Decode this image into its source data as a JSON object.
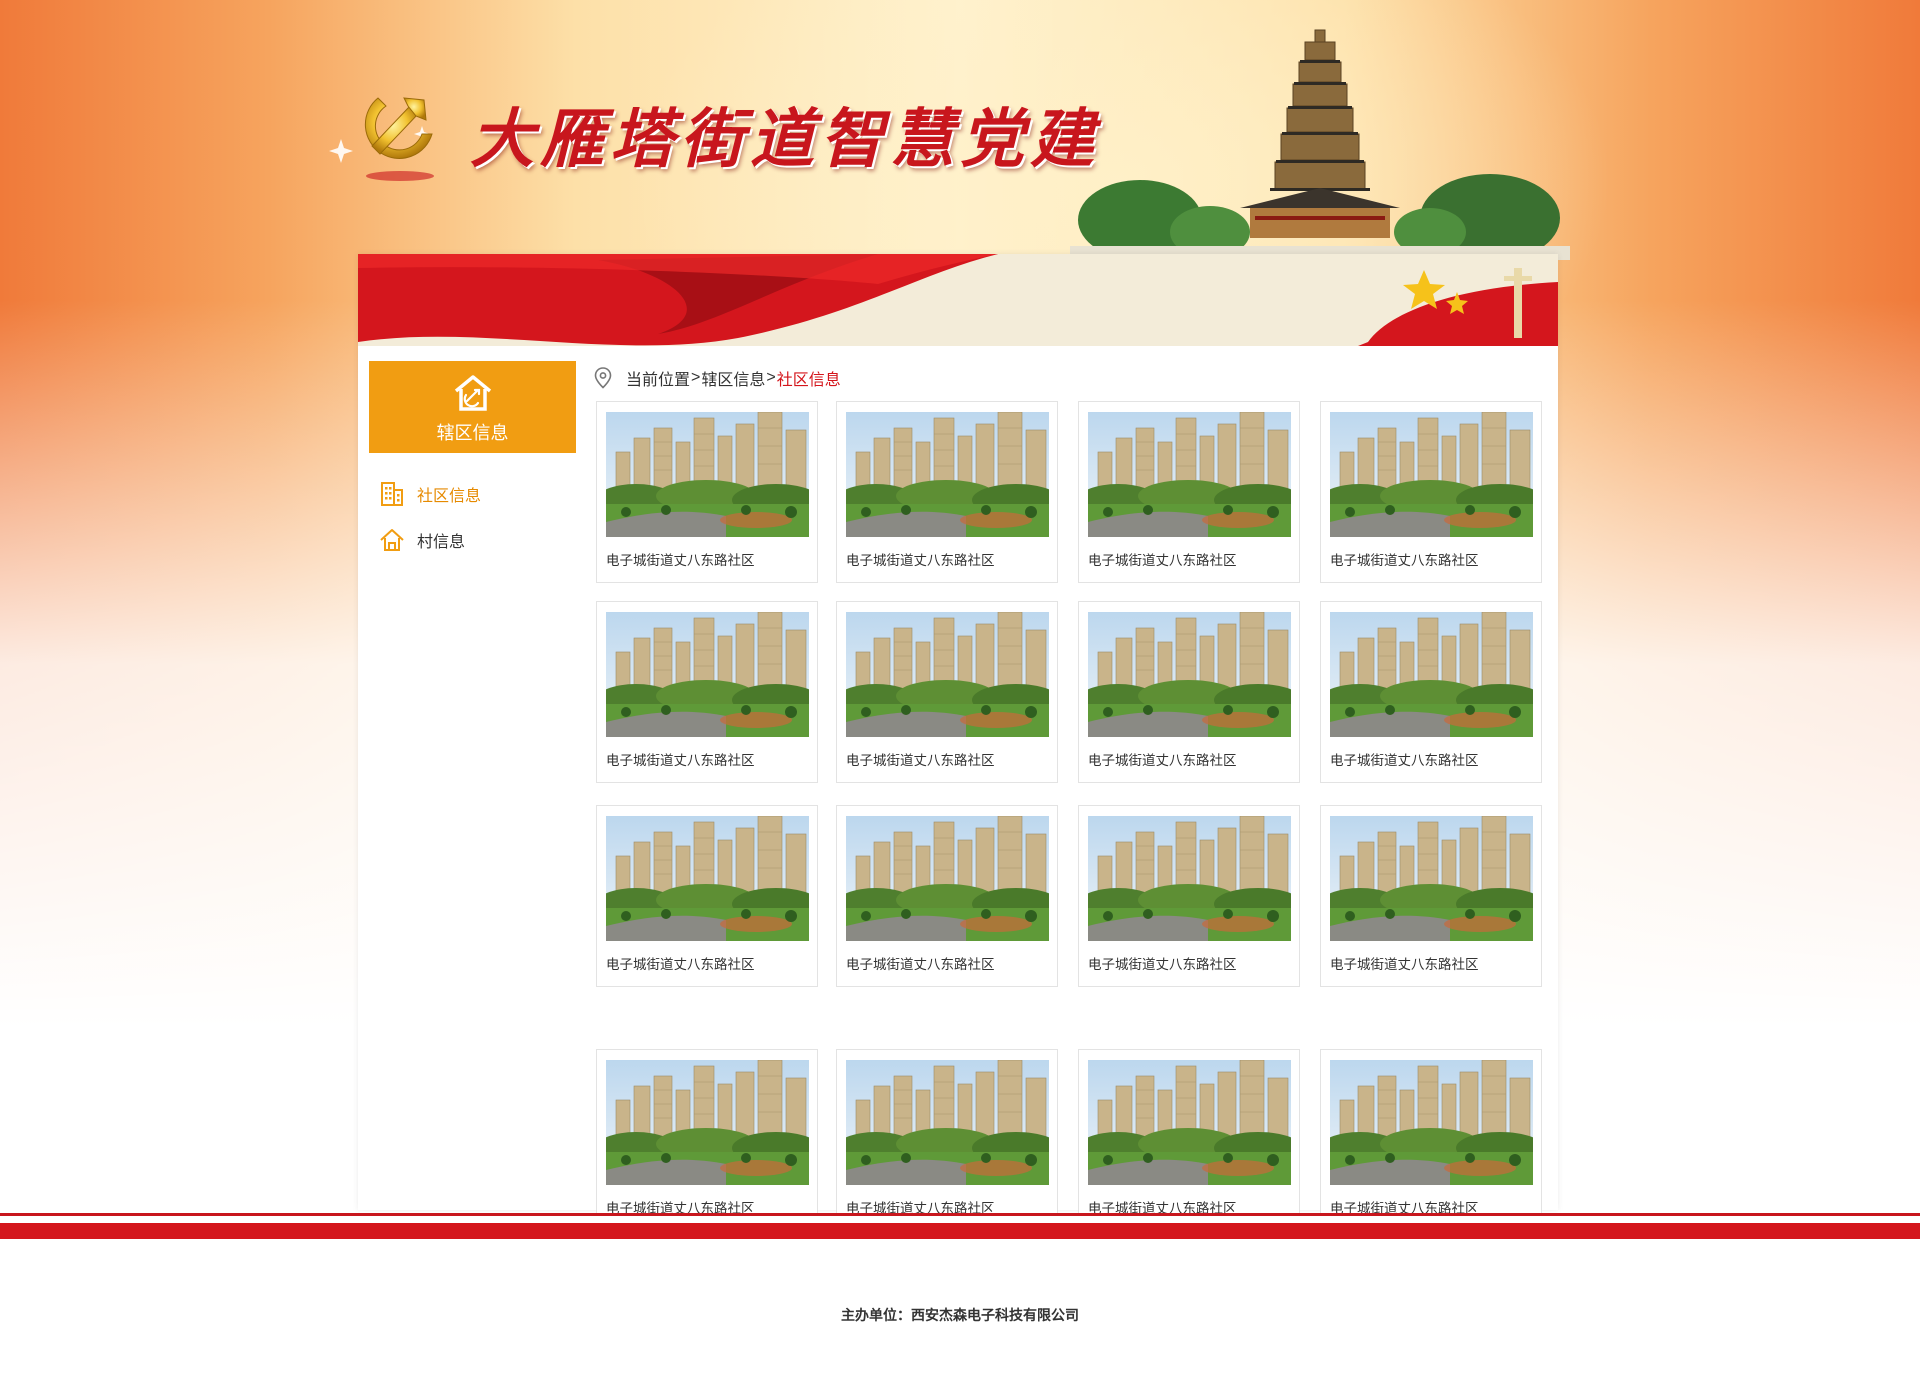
{
  "header": {
    "site_title": "大雁塔街道智慧党建"
  },
  "sidebar": {
    "title": "辖区信息",
    "items": [
      {
        "label": "社区信息",
        "icon": "building-icon",
        "active": true
      },
      {
        "label": "村信息",
        "icon": "home-icon",
        "active": false
      }
    ]
  },
  "breadcrumb": {
    "prefix": "当前位置",
    "sep": ">",
    "level1": "辖区信息",
    "current": "社区信息"
  },
  "cards": [
    {
      "caption": "电子城街道丈八东路社区"
    },
    {
      "caption": "电子城街道丈八东路社区"
    },
    {
      "caption": "电子城街道丈八东路社区"
    },
    {
      "caption": "电子城街道丈八东路社区"
    },
    {
      "caption": "电子城街道丈八东路社区"
    },
    {
      "caption": "电子城街道丈八东路社区"
    },
    {
      "caption": "电子城街道丈八东路社区"
    },
    {
      "caption": "电子城街道丈八东路社区"
    },
    {
      "caption": "电子城街道丈八东路社区"
    },
    {
      "caption": "电子城街道丈八东路社区"
    },
    {
      "caption": "电子城街道丈八东路社区"
    },
    {
      "caption": "电子城街道丈八东路社区"
    },
    {
      "caption": "电子城街道丈八东路社区"
    },
    {
      "caption": "电子城街道丈八东路社区"
    },
    {
      "caption": "电子城街道丈八东路社区"
    },
    {
      "caption": "电子城街道丈八东路社区"
    }
  ],
  "footer": {
    "organizer_label": "主办单位：",
    "organizer": "西安杰森电子科技有限公司"
  },
  "colors": {
    "party_red": "#c8161d",
    "accent_orange": "#f19d12",
    "active_link": "#e68a00",
    "breadcrumb_current": "#d4151b"
  }
}
